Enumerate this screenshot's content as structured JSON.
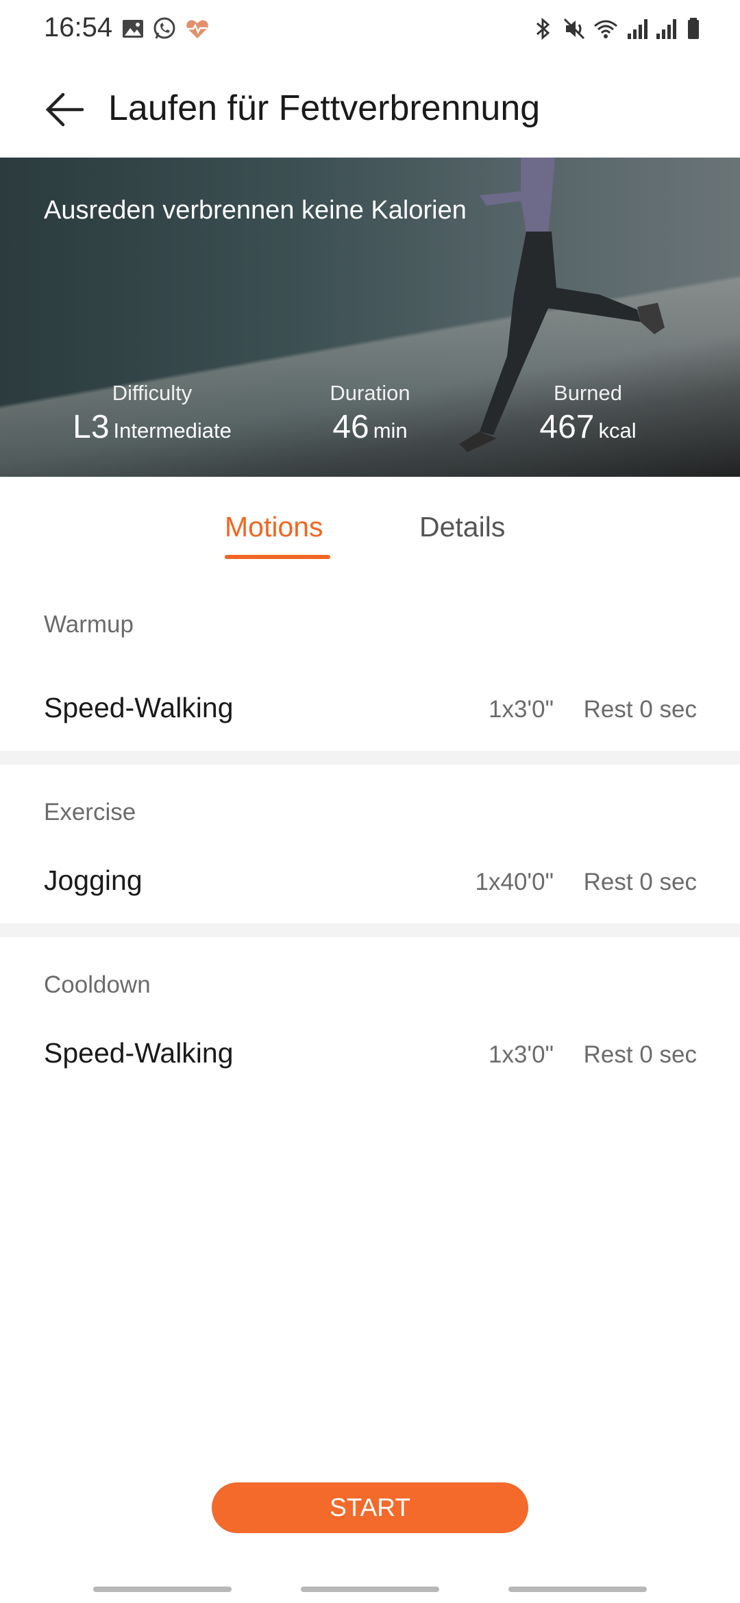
{
  "status_bar": {
    "time": "16:54"
  },
  "header": {
    "title": "Laufen für Fettverbrennung"
  },
  "hero": {
    "slogan": "Ausreden verbrennen keine Kalorien",
    "stats": [
      {
        "label": "Difficulty",
        "value": "L3",
        "unit": "Intermediate"
      },
      {
        "label": "Duration",
        "value": "46",
        "unit": "min"
      },
      {
        "label": "Burned",
        "value": "467",
        "unit": "kcal"
      }
    ]
  },
  "tabs": [
    {
      "label": "Motions",
      "active": true
    },
    {
      "label": "Details",
      "active": false
    }
  ],
  "sections": [
    {
      "label": "Warmup",
      "items": [
        {
          "name": "Speed-Walking",
          "sets": "1x3'0\"",
          "rest": "Rest 0 sec"
        }
      ]
    },
    {
      "label": "Exercise",
      "items": [
        {
          "name": "Jogging",
          "sets": "1x40'0\"",
          "rest": "Rest 0 sec"
        }
      ]
    },
    {
      "label": "Cooldown",
      "items": [
        {
          "name": "Speed-Walking",
          "sets": "1x3'0\"",
          "rest": "Rest 0 sec"
        }
      ]
    }
  ],
  "actions": {
    "start_label": "START"
  },
  "colors": {
    "accent": "#f26522",
    "start_button": "#f36a2b"
  }
}
